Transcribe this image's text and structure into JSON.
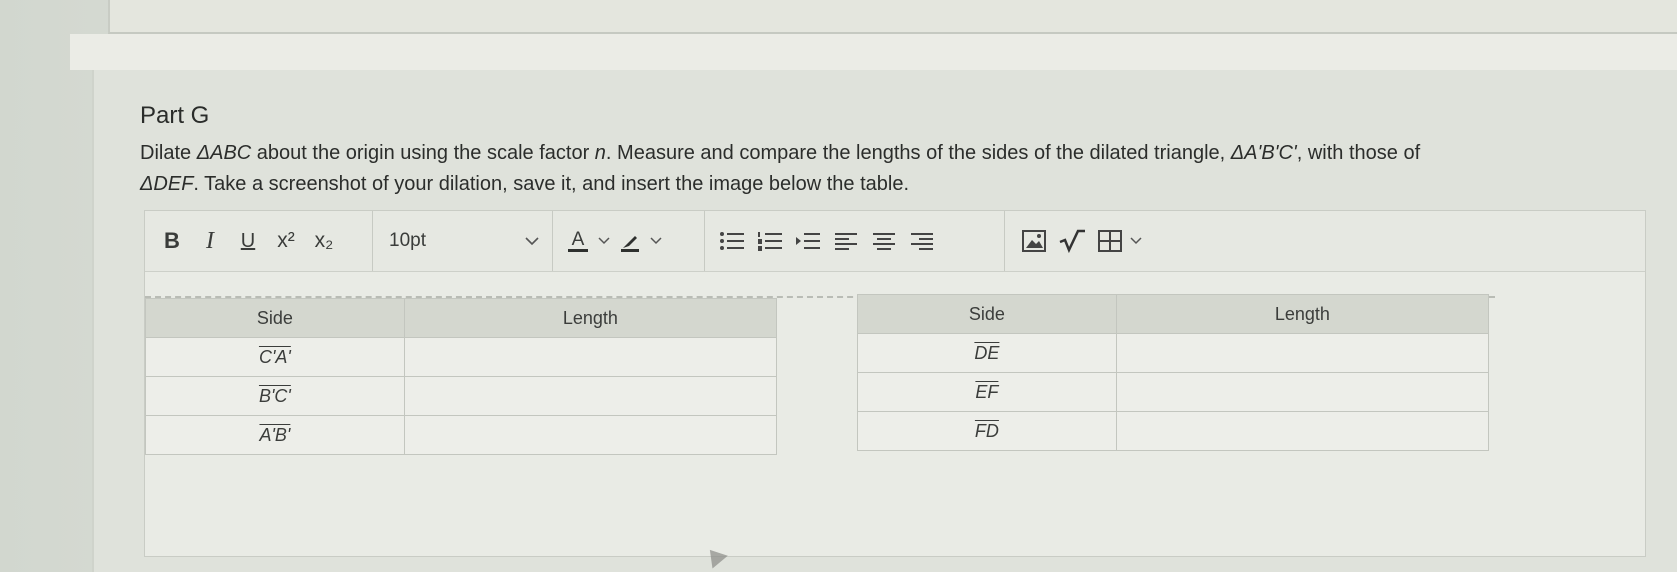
{
  "question": {
    "part_title": "Part G",
    "line1_a": "Dilate ",
    "line1_tri": "ΔABC",
    "line1_b": " about the origin using the scale factor ",
    "line1_n": "n",
    "line1_c": ". Measure and compare the lengths of the sides of the dilated triangle, ",
    "line1_tri2": "ΔA'B'C'",
    "line1_d": ", with those of",
    "line2_tri": "ΔDEF",
    "line2_a": ". Take a screenshot of your dilation, save it, and insert the image below the table."
  },
  "toolbar": {
    "bold_label": "B",
    "italic_label": "I",
    "underline_label": "U",
    "superscript_label": "x²",
    "subscript_label": "x₂",
    "font_size_value": "10pt",
    "font_color_label": "A",
    "icons": [
      "bold-icon",
      "italic-icon",
      "underline-icon",
      "superscript-icon",
      "subscript-icon",
      "chevron-down-icon",
      "font-color-icon",
      "highlighter-icon",
      "bullet-list-icon",
      "numbered-list-icon",
      "indent-icon",
      "align-left-icon",
      "align-center-icon",
      "align-right-icon",
      "insert-image-icon",
      "math-equation-icon",
      "table-icon"
    ]
  },
  "table_left": {
    "headers": [
      "Side",
      "Length"
    ],
    "rows": [
      {
        "side": "C'A'",
        "length": ""
      },
      {
        "side": "B'C'",
        "length": ""
      },
      {
        "side": "A'B'",
        "length": ""
      }
    ]
  },
  "table_right": {
    "headers": [
      "Side",
      "Length"
    ],
    "rows": [
      {
        "side": "DE",
        "length": ""
      },
      {
        "side": "EF",
        "length": ""
      },
      {
        "side": "FD",
        "length": ""
      }
    ]
  },
  "colors": {
    "background": "#dde1da",
    "header_cell": "#d4d7cf",
    "body_cell": "#edeee9",
    "text": "#2b2d2b"
  }
}
